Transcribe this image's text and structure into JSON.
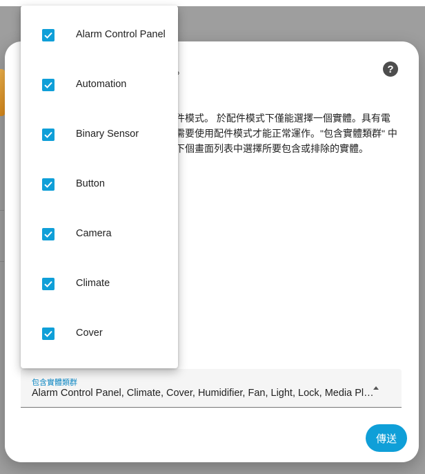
{
  "dialog": {
    "title_fragment": "。",
    "help_icon": "question-circle-icon",
    "description_lines": [
      "件模式。 於配件模式下僅能選擇一個實體。具有電",
      "需要使用配件模式才能正常運作。\"包含實體類群\" 中",
      "下個畫面列表中選擇所要包含或排除的實體。"
    ]
  },
  "field": {
    "label": "包含實體類群",
    "value": "Alarm Control Panel, Climate, Cover, Humidifier, Fan, Light, Lock, Media Player, Remote, Sensor, Switch, Vacuum, Water Heater"
  },
  "submit": {
    "label": "傳送"
  },
  "menu": {
    "items": [
      {
        "label": "Alarm Control Panel",
        "checked": true
      },
      {
        "label": "Automation",
        "checked": true
      },
      {
        "label": "Binary Sensor",
        "checked": true
      },
      {
        "label": "Button",
        "checked": true
      },
      {
        "label": "Camera",
        "checked": true
      },
      {
        "label": "Climate",
        "checked": true
      },
      {
        "label": "Cover",
        "checked": true
      }
    ]
  },
  "colors": {
    "accent": "#0f9fd8",
    "scrim": "#9e9e9e"
  }
}
